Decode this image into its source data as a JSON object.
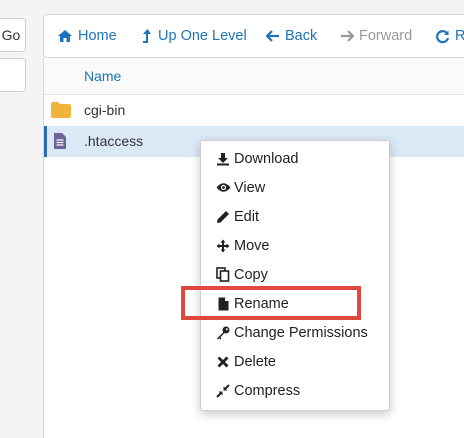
{
  "left_panel": {
    "go_label": "Go"
  },
  "toolbar": {
    "home_label": "Home",
    "up_label": "Up One Level",
    "back_label": "Back",
    "forward_label": "Forward",
    "reload_label": "Re"
  },
  "file_list": {
    "column_name": "Name",
    "rows": [
      {
        "name": "cgi-bin",
        "icon": "folder-icon"
      },
      {
        "name": ".htaccess",
        "icon": "text-file-icon",
        "selected": true
      }
    ]
  },
  "context_menu": {
    "items": [
      {
        "label": "Download",
        "icon": "download-icon"
      },
      {
        "label": "View",
        "icon": "eye-icon"
      },
      {
        "label": "Edit",
        "icon": "pencil-icon"
      },
      {
        "label": "Move",
        "icon": "move-arrows-icon"
      },
      {
        "label": "Copy",
        "icon": "copy-icon"
      },
      {
        "label": "Rename",
        "icon": "file-icon",
        "highlighted": true
      },
      {
        "label": "Change Permissions",
        "icon": "key-icon"
      },
      {
        "label": "Delete",
        "icon": "x-icon"
      },
      {
        "label": "Compress",
        "icon": "compress-icon"
      }
    ]
  },
  "colors": {
    "link_blue": "#1e74b9",
    "selected_row": "#dbe8f6",
    "highlight_red": "#e0473f",
    "folder_yellow": "#f0b43c"
  }
}
